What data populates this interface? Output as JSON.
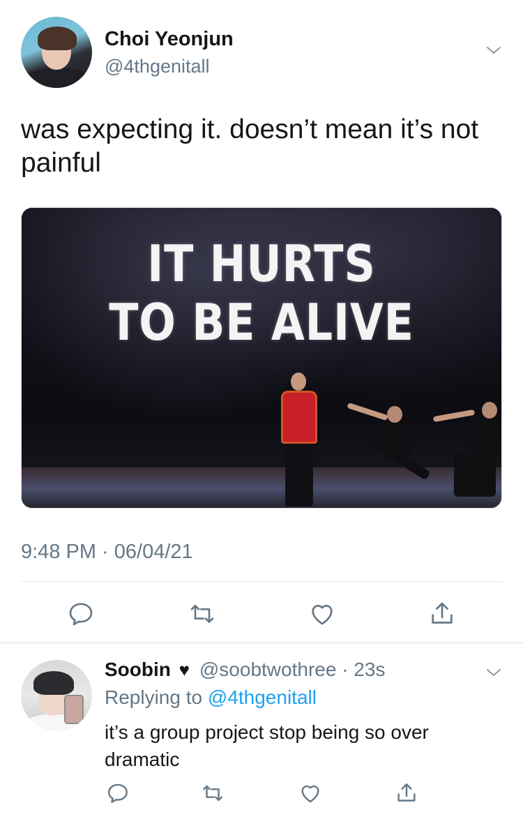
{
  "tweet": {
    "author_name": "Choi Yeonjun",
    "author_handle": "@4thgenitall",
    "text": "was expecting it. doesn’t mean it’s not painful",
    "media_caption": "IT HURTS TO BE ALIVE",
    "timestamp": "9:48 PM · 06/04/21",
    "actions": [
      "reply-icon",
      "retweet-icon",
      "like-icon",
      "share-icon"
    ]
  },
  "reply": {
    "author_name": "Soobin",
    "name_emoji": "♥",
    "author_handle": "@soobtwothree",
    "time": "· 23s",
    "replying_label": "Replying to",
    "replying_mention": "@4thgenitall",
    "text": "it’s a group project stop being so over dramatic",
    "actions": [
      "reply-icon",
      "retweet-icon",
      "like-icon",
      "share-icon"
    ]
  },
  "colors": {
    "text_primary": "#14171a",
    "text_secondary": "#657786",
    "link": "#1da1f2",
    "divider": "#e1e8ed"
  }
}
